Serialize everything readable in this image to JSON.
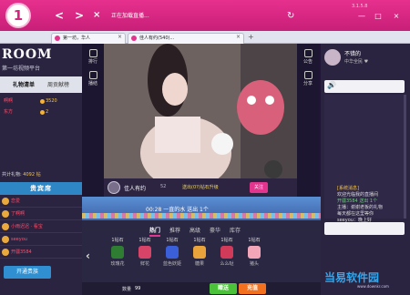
{
  "app": {
    "logo_glyph": "1",
    "version": "3.1.5.8",
    "address": "正在加载直播...",
    "nav": {
      "back": "<",
      "forward": ">",
      "close_tab": "×",
      "reload": "↻"
    },
    "window": {
      "min": "—",
      "max": "□",
      "close": "×"
    }
  },
  "tabs": [
    {
      "label": "第一坊，华人"
    },
    {
      "label": "佳人有约(540)..."
    }
  ],
  "tabs_new": "+",
  "left": {
    "room_title": "ROOM",
    "room_subtitle": "第一坊视频平台",
    "tabs": [
      "礼物清单",
      "周贡献榜"
    ],
    "ranking": [
      {
        "name": "啊啊",
        "score": "3520"
      },
      {
        "name": "东方",
        "score": "2"
      }
    ],
    "total_label": "共计礼物:",
    "total_value": "4092 钻",
    "vip_header": "贵宾席",
    "vip": [
      "恋爱",
      "了啊啊",
      "小雨迟迟 · 看宝",
      "seeyou",
      "开疆3584",
      "",
      "网"
    ],
    "open_vip": "开通贵族"
  },
  "icon_column": [
    {
      "label": "排行",
      "icon": "rank-icon"
    },
    {
      "label": "播结",
      "icon": "broadcast-icon"
    }
  ],
  "right_column": [
    {
      "label": "公告",
      "icon": "notice-icon"
    },
    {
      "label": "分享",
      "icon": "share-icon"
    }
  ],
  "host": {
    "name": "佳人有约",
    "fans": "52",
    "gift_message": "送出(0?)钻石升级",
    "follow": "关注"
  },
  "marquee": {
    "text": "00:28  一直的水 送出  1个"
  },
  "gift_tabs": [
    "热门",
    "推荐",
    "高级",
    "豪华",
    "库存"
  ],
  "gifts": [
    {
      "price": "1钻石",
      "name": "玫瑰花",
      "color": "#2e7d32"
    },
    {
      "price": "1钻石",
      "name": "鲜花",
      "color": "#d84368"
    },
    {
      "price": "1钻石",
      "name": "蓝色妖姬",
      "color": "#3b5fd9"
    },
    {
      "price": "1钻石",
      "name": "糖果",
      "color": "#e8a33a"
    },
    {
      "price": "1钻石",
      "name": "么么哒",
      "color": "#d23a5a"
    },
    {
      "price": "1钻石",
      "name": "猪头",
      "color": "#f2a6b8"
    }
  ],
  "bottom": {
    "qty_label": "数量",
    "qty_value": "99",
    "give": "赠送",
    "recharge": "充值"
  },
  "right": {
    "user_name": "不错的",
    "user_sub": "中华全民 ♥",
    "chat_lines": [
      {
        "text": "[系统消息]",
        "cls": "hl"
      },
      {
        "text": "欢迎光临我的直播间",
        "cls": ""
      },
      {
        "text": "开疆3584 送出 1个",
        "cls": "gr"
      },
      {
        "text": "主播：谢谢老板的礼物",
        "cls": ""
      },
      {
        "text": "每天都在这里等你",
        "cls": ""
      },
      {
        "text": "seeyou：晚上好",
        "cls": ""
      }
    ]
  },
  "watermark": {
    "title": "当易软件园",
    "url": "www.downkr.com"
  }
}
